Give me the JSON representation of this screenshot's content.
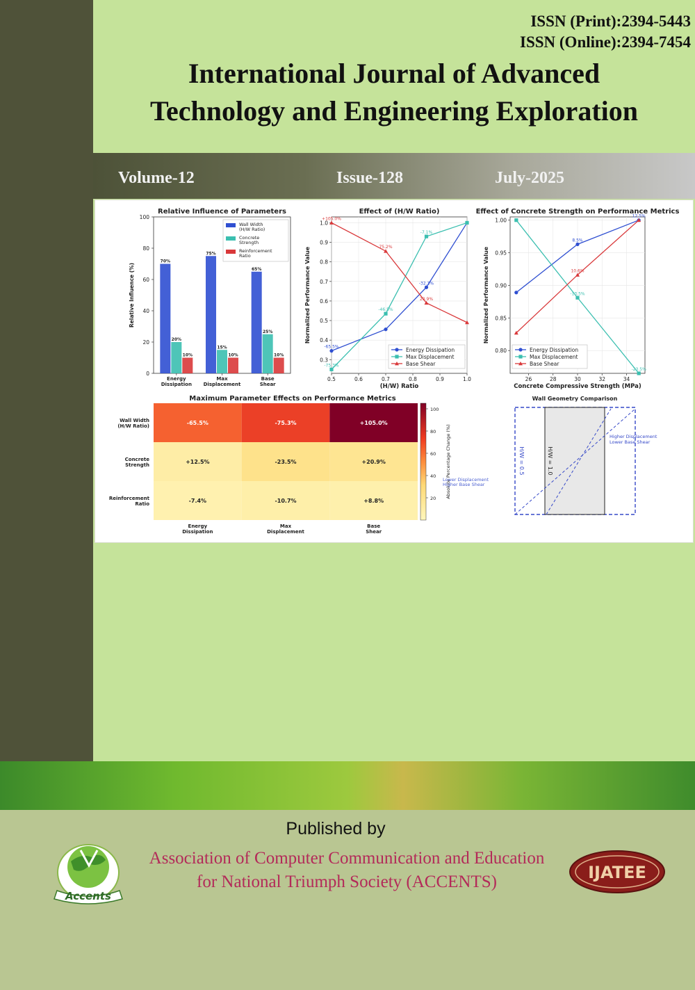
{
  "header": {
    "issn_print": "ISSN (Print):2394-5443",
    "issn_online": "ISSN (Online):2394-7454",
    "journal_title_line1": "International Journal of Advanced",
    "journal_title_line2": "Technology and Engineering Exploration"
  },
  "issue_bar": {
    "volume": "Volume-12",
    "issue": "Issue-128",
    "date": "July-2025"
  },
  "footer": {
    "published_by": "Published by",
    "publisher_line1": "Association of Computer Communication and Education",
    "publisher_line2": "for National Triumph Society (ACCENTS)",
    "left_logo_text": "Accents",
    "right_logo_text": "IJATEE"
  },
  "colors": {
    "background_green": "#c5e39a",
    "sidebar": "#4f5239",
    "publisher_text": "#b32a59",
    "energy": "#2f4fd1",
    "displacement": "#3bbfb0",
    "shear": "#d9383a"
  },
  "chart_data": [
    {
      "type": "bar",
      "title": "Relative Influence of Parameters",
      "ylabel": "Relative Influence (%)",
      "xlabel": "",
      "ylim": [
        0,
        100
      ],
      "yticks": [
        "0",
        "20",
        "40",
        "60",
        "80",
        "100"
      ],
      "categories": [
        [
          "Energy",
          "Dissipation"
        ],
        [
          "Max",
          "Displacement"
        ],
        [
          "Base",
          "Shear"
        ]
      ],
      "series": [
        {
          "name": "Wall Width (H/W Ratio)",
          "legend_lines": [
            "Wall Width",
            "(H/W Ratio)"
          ],
          "values": [
            70,
            75,
            65
          ],
          "labels": [
            "70%",
            "75%",
            "65%"
          ]
        },
        {
          "name": "Concrete Strength",
          "legend_lines": [
            "Concrete",
            "Strength"
          ],
          "values": [
            20,
            15,
            25
          ],
          "labels": [
            "20%",
            "15%",
            "25%"
          ]
        },
        {
          "name": "Reinforcement Ratio",
          "legend_lines": [
            "Reinforcement",
            "Ratio"
          ],
          "values": [
            10,
            10,
            10
          ],
          "labels": [
            "10%",
            "10%",
            "10%"
          ]
        }
      ],
      "legend": "top-right"
    },
    {
      "type": "line",
      "title": "Effect of (H/W Ratio)",
      "xlabel": "(H/W) Ratio",
      "ylabel": "Normalized Performance Value",
      "xlim": [
        0.5,
        1.0
      ],
      "ylim": [
        0.23,
        1.03
      ],
      "xticks": [
        "0.5",
        "0.6",
        "0.7",
        "0.8",
        "0.9",
        "1.0"
      ],
      "yticks": [
        "0.3",
        "0.4",
        "0.5",
        "0.6",
        "0.7",
        "0.8",
        "0.9",
        "1.0"
      ],
      "x": [
        0.5,
        0.7,
        0.85,
        1.0
      ],
      "series": [
        {
          "name": "Energy Dissipation",
          "values": [
            0.345,
            0.455,
            0.67,
            1.0
          ],
          "labels": [
            "-65.5%",
            "",
            "-32.3%",
            ""
          ]
        },
        {
          "name": "Max Displacement",
          "values": [
            0.25,
            0.535,
            0.93,
            1.0
          ],
          "labels": [
            "-75.3%",
            "-46.5%",
            "-7.1%",
            ""
          ]
        },
        {
          "name": "Base Shear",
          "values": [
            1.0,
            0.855,
            0.59,
            0.49
          ],
          "labels": [
            "+105.0%",
            "75.2%",
            "20.9%",
            ""
          ]
        }
      ],
      "grid": true,
      "legend": "bottom-right"
    },
    {
      "type": "line",
      "title": "Effect of Concrete Strength on Performance Metrics",
      "xlabel": "Concrete Compressive Strength (MPa)",
      "ylabel": "Normalized Performance Value",
      "xlim": [
        24.5,
        35.5
      ],
      "ylim": [
        0.765,
        1.005
      ],
      "xticks": [
        "26",
        "28",
        "30",
        "32",
        "34"
      ],
      "yticks": [
        "0.80",
        "0.85",
        "0.90",
        "0.95",
        "1.00"
      ],
      "x": [
        25,
        30,
        35
      ],
      "series": [
        {
          "name": "Energy Dissipation",
          "values": [
            0.889,
            0.963,
            1.0
          ],
          "labels": [
            "",
            "8.5%",
            "12.5%"
          ]
        },
        {
          "name": "Max Displacement",
          "values": [
            1.0,
            0.881,
            0.765
          ],
          "labels": [
            "",
            "-13.5%",
            "-23.5%"
          ]
        },
        {
          "name": "Base Shear",
          "values": [
            0.827,
            0.916,
            1.0
          ],
          "labels": [
            "",
            "10.6%",
            ""
          ]
        }
      ],
      "grid": true,
      "legend": "bottom-left"
    },
    {
      "type": "heatmap",
      "title": "Maximum Parameter Effects on Performance Metrics",
      "rows": [
        [
          "Wall Width",
          "(H/W Ratio)"
        ],
        [
          "Concrete",
          "Strength"
        ],
        [
          "Reinforcement",
          "Ratio"
        ]
      ],
      "columns": [
        [
          "Energy",
          "Dissipation"
        ],
        [
          "Max",
          "Displacement"
        ],
        [
          "Base",
          "Shear"
        ]
      ],
      "values": [
        [
          -65.5,
          -75.3,
          105.0
        ],
        [
          12.5,
          -23.5,
          20.9
        ],
        [
          -7.4,
          -10.7,
          8.8
        ]
      ],
      "labels": [
        [
          "-65.5%",
          "-75.3%",
          "+105.0%"
        ],
        [
          "+12.5%",
          "-23.5%",
          "+20.9%"
        ],
        [
          "-7.4%",
          "-10.7%",
          "+8.8%"
        ]
      ],
      "colorbar_label": "Absolute Percentage Change (%)",
      "colorbar_ticks": [
        "100",
        "80",
        "60",
        "40",
        "20"
      ],
      "annotation_lines": [
        "Lower Displacement",
        "Higher Base Shear"
      ]
    },
    {
      "type": "diagram",
      "title": "Wall Geometry Comparison",
      "wall_labels": [
        "H/W = 0.5",
        "H/W = 1.0"
      ],
      "annotation_lines": [
        "Higher Displacement",
        "Lower Base Shear"
      ]
    }
  ]
}
